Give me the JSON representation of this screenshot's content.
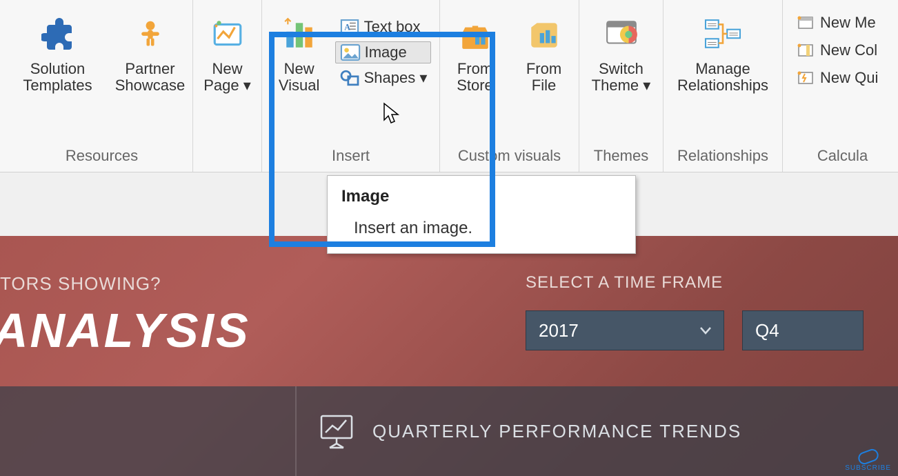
{
  "ribbon": {
    "resources": {
      "solution_templates": "Solution\nTemplates",
      "partner_showcase": "Partner\nShowcase",
      "group_label": "Resources"
    },
    "page": {
      "new_page": "New\nPage ▾"
    },
    "insert": {
      "new_visual": "New\nVisual",
      "text_box": "Text box",
      "image": "Image",
      "shapes": "Shapes ▾",
      "group_label": "Insert"
    },
    "custom_visuals": {
      "from_store": "From\nStore",
      "from_file": "From\nFile",
      "group_label": "Custom visuals"
    },
    "themes": {
      "switch_theme": "Switch\nTheme ▾",
      "group_label": "Themes"
    },
    "relationships": {
      "manage": "Manage\nRelationships",
      "group_label": "Relationships"
    },
    "calculations": {
      "new_me": "New Me",
      "new_col": "New Col",
      "new_qui": "New Qui",
      "group_label": "Calcula"
    }
  },
  "tooltip": {
    "title": "Image",
    "desc": "Insert an image."
  },
  "dashboard": {
    "hint": "TORS SHOWING?",
    "title": "ANALYSIS",
    "timeframe_label": "SELECT A TIME FRAME",
    "year": "2017",
    "quarter": "Q4",
    "panel_right_title": "QUARTERLY PERFORMANCE TRENDS"
  },
  "subscribe": "SUBSCRIBE"
}
